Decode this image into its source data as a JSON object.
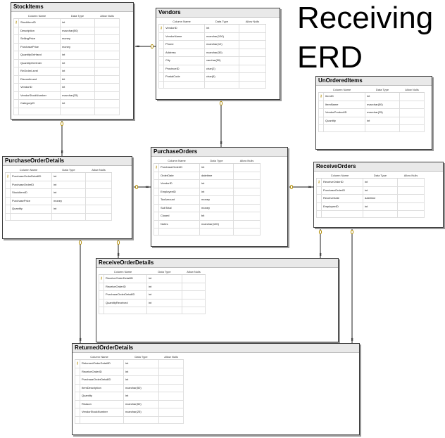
{
  "heading": {
    "line1": "Receiving",
    "line2": "ERD"
  },
  "column_headers": {
    "name": "Column Name",
    "type": "Data Type",
    "nulls": "Allow Nulls"
  },
  "key_icon": "key-icon",
  "tables": {
    "stock_items": {
      "title": "StockItems",
      "rows": [
        {
          "pk": true,
          "name": "StockItemID",
          "type": "int"
        },
        {
          "name": "Description",
          "type": "nvarchar(50)"
        },
        {
          "name": "SellingPrice",
          "type": "money"
        },
        {
          "name": "PurchasePrice",
          "type": "money"
        },
        {
          "name": "QuantityOnHand",
          "type": "int"
        },
        {
          "name": "QuantityOnOrder",
          "type": "int"
        },
        {
          "name": "ReOrderLevel",
          "type": "int"
        },
        {
          "name": "Discontinued",
          "type": "bit"
        },
        {
          "name": "VendorID",
          "type": "int"
        },
        {
          "name": "VendorStockNumber",
          "type": "nvarchar(25)"
        },
        {
          "name": "CategoryID",
          "type": "int"
        }
      ]
    },
    "vendors": {
      "title": "Vendors",
      "rows": [
        {
          "pk": true,
          "name": "VendorID",
          "type": "int"
        },
        {
          "name": "VendorName",
          "type": "nvarchar(100)"
        },
        {
          "name": "Phone",
          "type": "nvarchar(12)"
        },
        {
          "name": "Address",
          "type": "nvarchar(30)"
        },
        {
          "name": "City",
          "type": "varchar(50)"
        },
        {
          "name": "ProvinceID",
          "type": "char(2)"
        },
        {
          "name": "PostalCode",
          "type": "char(6)"
        }
      ]
    },
    "unordered_items": {
      "title": "UnOrderedItems",
      "rows": [
        {
          "pk": true,
          "name": "ItemID",
          "type": "int"
        },
        {
          "name": "ItemName",
          "type": "nvarchar(50)"
        },
        {
          "name": "VendorProductID",
          "type": "nvarchar(25)"
        },
        {
          "name": "Quantity",
          "type": "int"
        }
      ]
    },
    "purchase_order_details": {
      "title": "PurchaseOrderDetails",
      "rows": [
        {
          "pk": true,
          "name": "PurchaseOrderDetailID",
          "type": "int"
        },
        {
          "name": "PurchaseOrderID",
          "type": "int"
        },
        {
          "name": "StockItemID",
          "type": "int"
        },
        {
          "name": "PurchasePrice",
          "type": "money"
        },
        {
          "name": "Quantity",
          "type": "int"
        }
      ]
    },
    "purchase_orders": {
      "title": "PurchaseOrders",
      "rows": [
        {
          "pk": true,
          "name": "PurchaseOrderID",
          "type": "int"
        },
        {
          "name": "OrderDate",
          "type": "datetime"
        },
        {
          "name": "VendorID",
          "type": "int"
        },
        {
          "name": "EmployeeID",
          "type": "int"
        },
        {
          "name": "TaxAmount",
          "type": "money"
        },
        {
          "name": "SubTotal",
          "type": "money"
        },
        {
          "name": "Closed",
          "type": "bit"
        },
        {
          "name": "Notes",
          "type": "nvarchar(100)"
        }
      ]
    },
    "receive_orders": {
      "title": "ReceiveOrders",
      "rows": [
        {
          "pk": true,
          "name": "ReceiveOrderID",
          "type": "int"
        },
        {
          "name": "PurchaseOrderID",
          "type": "int"
        },
        {
          "name": "ReceiveDate",
          "type": "datetime"
        },
        {
          "name": "EmployeeID",
          "type": "int"
        }
      ]
    },
    "receive_order_details": {
      "title": "ReceiveOrderDetails",
      "rows": [
        {
          "pk": true,
          "name": "ReceiveOrderDetailID",
          "type": "int"
        },
        {
          "name": "ReceiveOrderID",
          "type": "int"
        },
        {
          "name": "PurchaseOrderDetailID",
          "type": "int"
        },
        {
          "name": "QuantityReceived",
          "type": "int"
        }
      ]
    },
    "returned_order_details": {
      "title": "ReturnedOrderDetails",
      "rows": [
        {
          "pk": true,
          "name": "ReturnedOrderDetailID",
          "type": "int"
        },
        {
          "name": "ReceiveOrderID",
          "type": "int"
        },
        {
          "name": "PurchaseOrderDetailID",
          "type": "int"
        },
        {
          "name": "ItemDescription",
          "type": "nvarchar(50)"
        },
        {
          "name": "Quantity",
          "type": "int"
        },
        {
          "name": "Reason",
          "type": "nvarchar(50)"
        },
        {
          "name": "VendorStockNumber",
          "type": "nvarchar(25)"
        }
      ]
    }
  }
}
